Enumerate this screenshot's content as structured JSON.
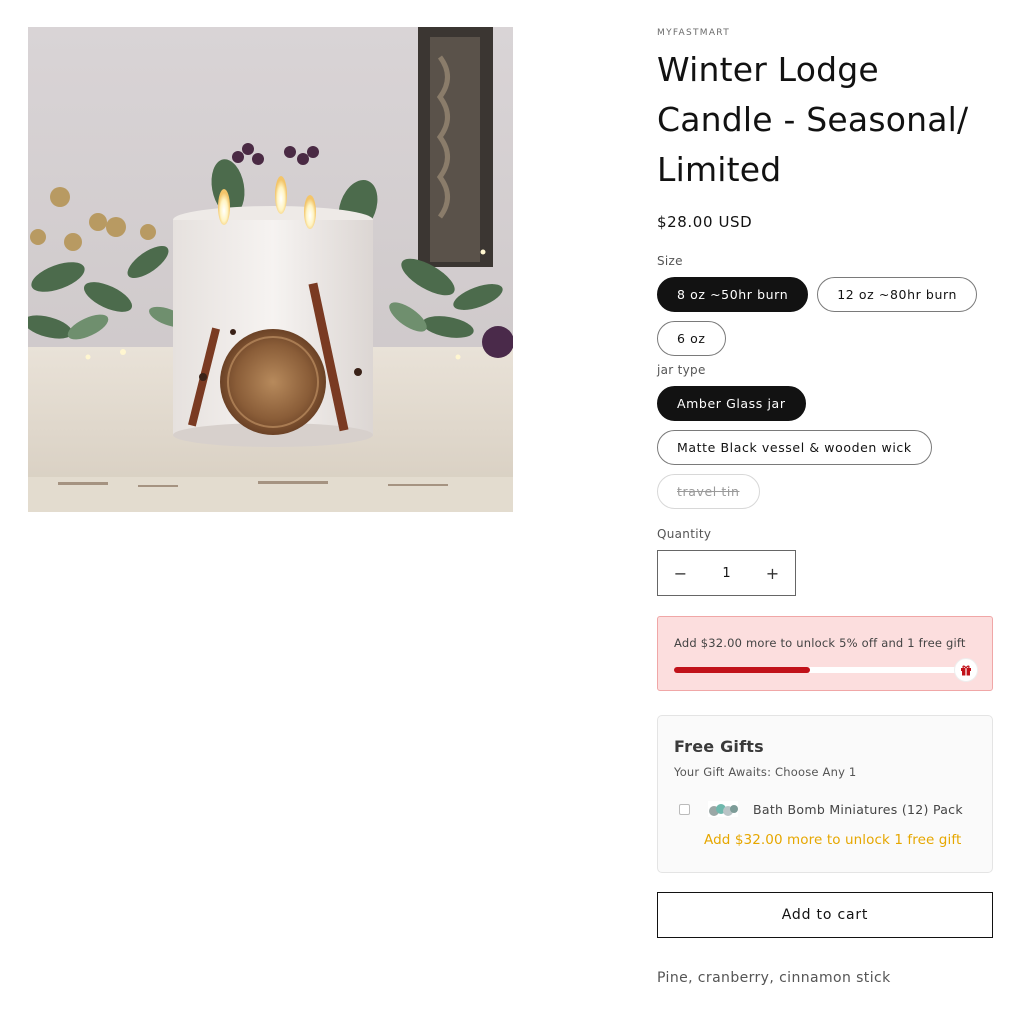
{
  "product": {
    "vendor": "MYFASTMART",
    "title": "Winter Lodge Candle - Seasonal/ Limited",
    "price": "$28.00 USD",
    "description": "Pine, cranberry, cinnamon stick"
  },
  "options": {
    "size": {
      "label": "Size",
      "values": [
        "8 oz ~50hr burn",
        "12 oz ~80hr burn",
        "6 oz"
      ],
      "selected": "8 oz ~50hr burn"
    },
    "jar": {
      "label": "jar type",
      "values": [
        "Amber Glass jar",
        "Matte Black vessel & wooden wick",
        "travel tin"
      ],
      "selected": "Amber Glass jar",
      "unavailable": [
        "travel tin"
      ]
    }
  },
  "quantity": {
    "label": "Quantity",
    "value": "1",
    "decrease_symbol": "−",
    "increase_symbol": "+"
  },
  "unlock_banner": {
    "text": "Add $32.00 more to unlock 5% off and 1 free gift",
    "progress_percent": 47,
    "colors": {
      "background": "#fcdede",
      "fill": "#c1121a"
    },
    "icon": "gift-icon"
  },
  "free_gifts": {
    "title": "Free Gifts",
    "subtitle": "Your Gift Awaits: Choose Any 1",
    "items": [
      {
        "name": "Bath Bomb Miniatures (12) Pack",
        "checked": false
      }
    ],
    "unlock_text": "Add $32.00 more to unlock 1 free gift",
    "unlock_color": "#e6a700"
  },
  "add_to_cart_label": "Add to cart"
}
